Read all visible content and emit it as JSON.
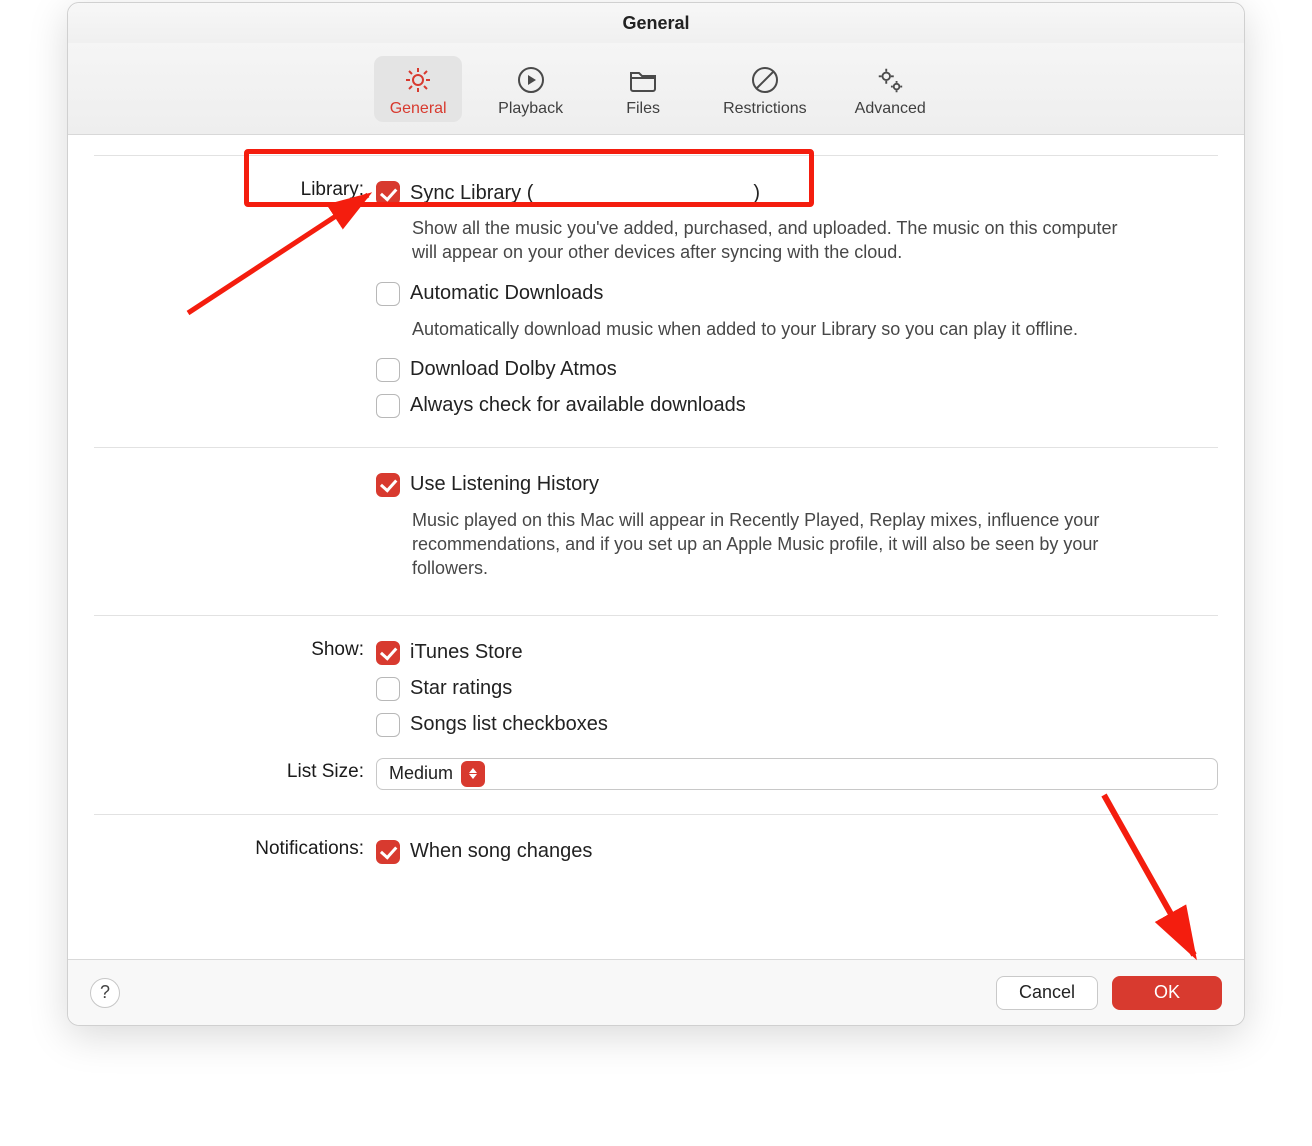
{
  "title": "General",
  "tabs": [
    {
      "label": "General",
      "icon": "gear",
      "active": true
    },
    {
      "label": "Playback",
      "icon": "play",
      "active": false
    },
    {
      "label": "Files",
      "icon": "folder",
      "active": false
    },
    {
      "label": "Restrictions",
      "icon": "nosign",
      "active": false
    },
    {
      "label": "Advanced",
      "icon": "gears",
      "active": false
    }
  ],
  "sections": {
    "library": {
      "label": "Library:",
      "sync_library": {
        "checked": true,
        "text_prefix": "Sync Library (",
        "text_suffix": ")",
        "desc": "Show all the music you've added, purchased, and uploaded. The music on this computer will appear on your other devices after syncing with the cloud."
      },
      "auto_downloads": {
        "checked": false,
        "text": "Automatic Downloads",
        "desc": "Automatically download music when added to your Library so you can play it offline."
      },
      "dolby": {
        "checked": false,
        "text": "Download Dolby Atmos"
      },
      "always_check": {
        "checked": false,
        "text": "Always check for available downloads"
      }
    },
    "history": {
      "use_history": {
        "checked": true,
        "text": "Use Listening History",
        "desc": "Music played on this Mac will appear in Recently Played, Replay mixes, influence your recommendations, and if you set up an Apple Music profile, it will also be seen by your followers."
      }
    },
    "show": {
      "label": "Show:",
      "itunes": {
        "checked": true,
        "text": "iTunes Store"
      },
      "stars": {
        "checked": false,
        "text": "Star ratings"
      },
      "checks": {
        "checked": false,
        "text": "Songs list checkboxes"
      }
    },
    "list_size": {
      "label": "List Size:",
      "value": "Medium"
    },
    "notifications": {
      "label": "Notifications:",
      "song_changes": {
        "checked": true,
        "text": "When song changes"
      }
    }
  },
  "footer": {
    "help": "?",
    "cancel": "Cancel",
    "ok": "OK"
  }
}
